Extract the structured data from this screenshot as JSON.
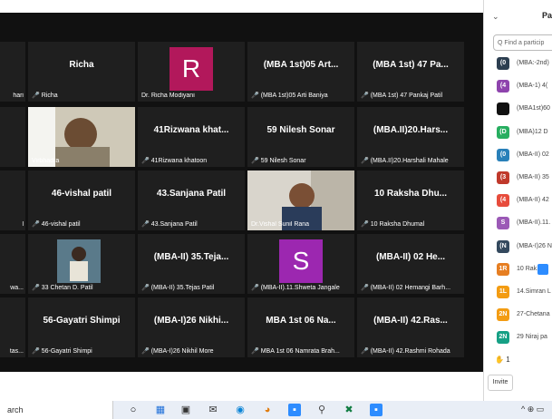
{
  "tiles": [
    {
      "big": "Richa",
      "cap": "Richa",
      "mic": true
    },
    {
      "big": "",
      "cap": "Dr. Richa Modiyani",
      "mic": false,
      "avatar": "R",
      "avatarColor": "#b2185b"
    },
    {
      "big": "(MBA 1st)05 Art...",
      "cap": "(MBA 1st)05 Arti Baniya",
      "mic": true
    },
    {
      "big": "(MBA 1st) 47 Pa...",
      "cap": "(MBA 1st) 47 Pankaj Patil",
      "mic": true
    },
    {
      "big": "",
      "cap": "Virbhadra",
      "mic": false,
      "photo": "person1"
    },
    {
      "big": "41Rizwana khat...",
      "cap": "41Rizwana khatoon",
      "mic": true
    },
    {
      "big": "59 Nilesh Sonar",
      "cap": "59 Nilesh Sonar",
      "mic": true
    },
    {
      "big": "(MBA.II)20.Hars...",
      "cap": "(MBA.II)20.Harshali Mahale",
      "mic": true
    },
    {
      "big": "46-vishal patil",
      "cap": "46-vishal patil",
      "mic": true
    },
    {
      "big": "43.Sanjana Patil",
      "cap": "43.Sanjana Patil",
      "mic": true
    },
    {
      "big": "",
      "cap": "Dr.Vishal Sunil Rana",
      "mic": false,
      "photo": "person2",
      "highlight": true
    },
    {
      "big": "10 Raksha Dhu...",
      "cap": "10 Raksha Dhumal",
      "mic": true
    },
    {
      "big": "",
      "cap": "33 Chetan D. Patil",
      "mic": true,
      "photo": "person3"
    },
    {
      "big": "(MBA-II) 35.Teja...",
      "cap": "(MBA-II) 35.Tejas Patil",
      "mic": true
    },
    {
      "big": "",
      "cap": "(MBA-II).11.Shweta Jangale",
      "mic": true,
      "avatar": "S",
      "avatarColor": "#9c27b0"
    },
    {
      "big": "(MBA-II) 02 He...",
      "cap": "(MBA-II) 02 Hemangi  Barh...",
      "mic": true
    },
    {
      "big": "56-Gayatri Shimpi",
      "cap": "56-Gayatri Shimpi",
      "mic": true
    },
    {
      "big": "(MBA-I)26 Nikhi...",
      "cap": "(MBA-I)26 Nikhil More",
      "mic": true
    },
    {
      "big": "MBA 1st 06 Na...",
      "cap": "MBA 1st 06 Namrata Brah...",
      "mic": true
    },
    {
      "big": "(MBA-II) 42.Ras...",
      "cap": "(MBA-II) 42.Rashmi Rohada",
      "mic": true
    }
  ],
  "leftEdge": [
    "hari",
    "",
    "l",
    "wa...",
    "tas..."
  ],
  "panel": {
    "title": "Pa",
    "find_placeholder": "Q Find a particip",
    "participants": [
      {
        "av": "(0",
        "color": "#2c3e50",
        "name": "(MBA:-2nd)"
      },
      {
        "av": "(4",
        "color": "#8e44ad",
        "name": "(MBA-1)  4("
      },
      {
        "av": "",
        "color": "#111111",
        "name": "(MBA1st)60"
      },
      {
        "av": "(D",
        "color": "#27ae60",
        "name": "(MBA)12 D"
      },
      {
        "av": "(0",
        "color": "#2980b9",
        "name": "(MBA-II) 02"
      },
      {
        "av": "(3",
        "color": "#c0392b",
        "name": "(MBA-II) 35"
      },
      {
        "av": "(4",
        "color": "#e74c3c",
        "name": "(MBA-II) 42"
      },
      {
        "av": "S",
        "color": "#9b59b6",
        "name": "(MBA-II).11."
      },
      {
        "av": "(N",
        "color": "#34495e",
        "name": "(MBA-I)26 N"
      },
      {
        "av": "1R",
        "color": "#e67e22",
        "name": "10 Rak..."
      },
      {
        "av": "1L",
        "color": "#f39c12",
        "name": "14.Simran L"
      },
      {
        "av": "2N",
        "color": "#f39c12",
        "name": "27-Chetana"
      },
      {
        "av": "2N",
        "color": "#16a085",
        "name": "29 Niraj pa"
      }
    ],
    "raised_count": "1",
    "invite_label": "Invite"
  },
  "taskbar": {
    "search_text": "arch",
    "tray": "^ ⊕ ▭"
  }
}
